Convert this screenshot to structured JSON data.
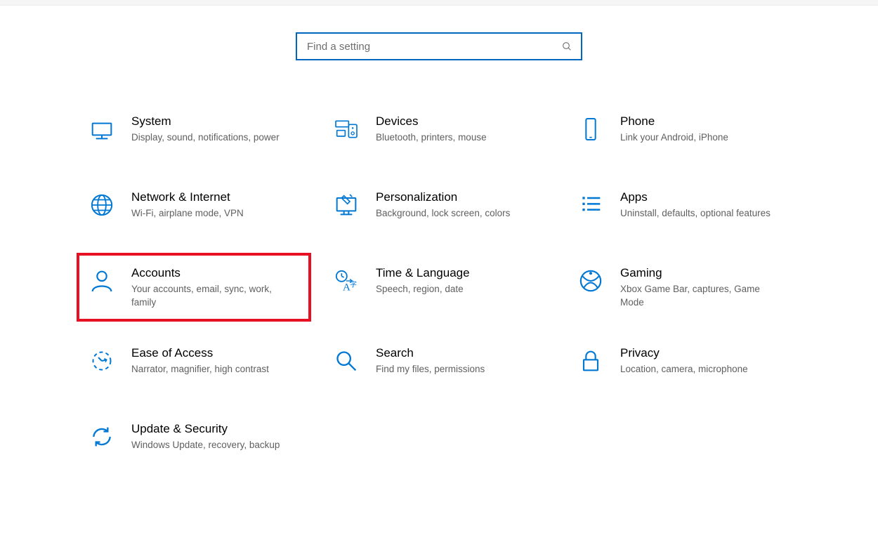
{
  "search": {
    "placeholder": "Find a setting"
  },
  "tiles": [
    {
      "icon": "system",
      "title": "System",
      "desc": "Display, sound, notifications, power"
    },
    {
      "icon": "devices",
      "title": "Devices",
      "desc": "Bluetooth, printers, mouse"
    },
    {
      "icon": "phone",
      "title": "Phone",
      "desc": "Link your Android, iPhone"
    },
    {
      "icon": "network",
      "title": "Network & Internet",
      "desc": "Wi-Fi, airplane mode, VPN"
    },
    {
      "icon": "personal",
      "title": "Personalization",
      "desc": "Background, lock screen, colors"
    },
    {
      "icon": "apps",
      "title": "Apps",
      "desc": "Uninstall, defaults, optional features"
    },
    {
      "icon": "accounts",
      "title": "Accounts",
      "desc": "Your accounts, email, sync, work, family",
      "highlight": true
    },
    {
      "icon": "time",
      "title": "Time & Language",
      "desc": "Speech, region, date"
    },
    {
      "icon": "gaming",
      "title": "Gaming",
      "desc": "Xbox Game Bar, captures, Game Mode"
    },
    {
      "icon": "ease",
      "title": "Ease of Access",
      "desc": "Narrator, magnifier, high contrast"
    },
    {
      "icon": "search",
      "title": "Search",
      "desc": "Find my files, permissions"
    },
    {
      "icon": "privacy",
      "title": "Privacy",
      "desc": "Location, camera, microphone"
    },
    {
      "icon": "update",
      "title": "Update & Security",
      "desc": "Windows Update, recovery, backup"
    }
  ]
}
